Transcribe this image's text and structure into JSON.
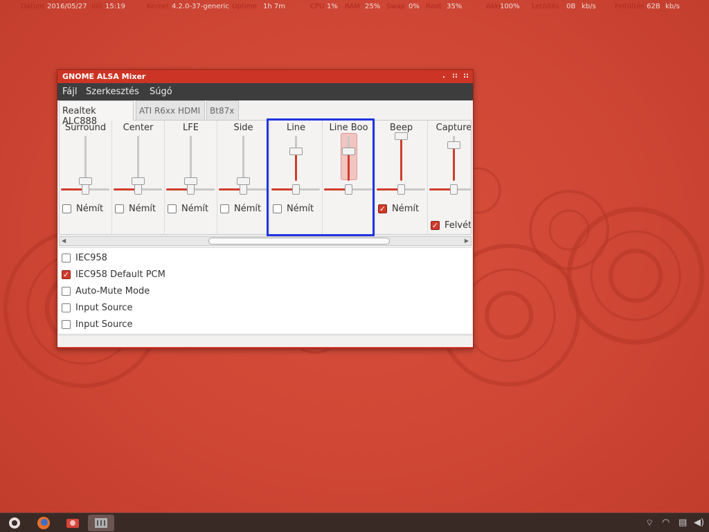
{
  "topbar": {
    "date_label": "Dátum",
    "date": "2016/05/27",
    "time_label": "Idő",
    "time": "15:19",
    "kernel_label": "Kernel",
    "kernel": "4.2.0-37-generic",
    "uptime_label": "Uptime",
    "uptime": "1h 7m",
    "cpu_label": "CPU",
    "cpu": "1%",
    "ram_label": "RAM",
    "ram": "25%",
    "swap_label": "Swap",
    "swap": "0%",
    "disk_label": "Root",
    "disk": "35%",
    "bat_label": "Akku",
    "bat": "100%",
    "down_label": "Letöltés",
    "down": "0B",
    "down_unit": "kb/s",
    "up_label": "Feltöltés",
    "up": "62B",
    "up_unit": "kb/s"
  },
  "window": {
    "title": "GNOME ALSA Mixer",
    "controls": [
      ".",
      "::",
      "::"
    ]
  },
  "menu": [
    "Fájl",
    "Szerkesztés",
    "Súgó"
  ],
  "tabs": [
    "Realtek ALC888",
    "ATI R6xx HDMI",
    "Bt87x"
  ],
  "channels": [
    {
      "name": "Surround",
      "mute_label": "Némít",
      "muted": false,
      "volume": 0.0,
      "balance": 0.5,
      "selected": false
    },
    {
      "name": "Center",
      "mute_label": "Némít",
      "muted": false,
      "volume": 0.0,
      "balance": 0.5,
      "selected": false
    },
    {
      "name": "LFE",
      "mute_label": "Némít",
      "muted": false,
      "volume": 0.0,
      "balance": 0.5,
      "selected": false
    },
    {
      "name": "Side",
      "mute_label": "Némít",
      "muted": false,
      "volume": 0.0,
      "balance": 0.5,
      "selected": false
    },
    {
      "name": "Line",
      "mute_label": "Némít",
      "muted": false,
      "volume": 0.66,
      "balance": 0.5,
      "selected": false
    },
    {
      "name": "Line Boo",
      "mute_label": "",
      "muted": false,
      "volume": 0.66,
      "balance": 0.5,
      "selected": true
    },
    {
      "name": "Beep",
      "mute_label": "Némít",
      "muted": true,
      "volume": 1.0,
      "balance": 0.5,
      "selected": false
    },
    {
      "name": "Capture",
      "mute_label": "",
      "muted": false,
      "volume": 0.8,
      "balance": 0.5,
      "selected": false,
      "capture_label": "Felvéte",
      "capture": true
    }
  ],
  "switches": [
    {
      "label": "IEC958",
      "checked": false
    },
    {
      "label": "IEC958 Default PCM",
      "checked": true
    },
    {
      "label": "Auto-Mute Mode",
      "checked": false
    },
    {
      "label": "Input Source",
      "checked": false
    },
    {
      "label": "Input Source",
      "checked": false
    }
  ],
  "colors": {
    "accent": "#d13c2c",
    "highlight": "#1f33e0",
    "menubar": "#3d3d3d"
  },
  "taskbar": {
    "launchers": [
      "ubuntu-logo-icon",
      "firefox-icon",
      "photos-icon",
      "mixer-icon"
    ],
    "tray": [
      "network-icon",
      "wifi-icon",
      "keyboard-icon",
      "volume-icon"
    ]
  }
}
